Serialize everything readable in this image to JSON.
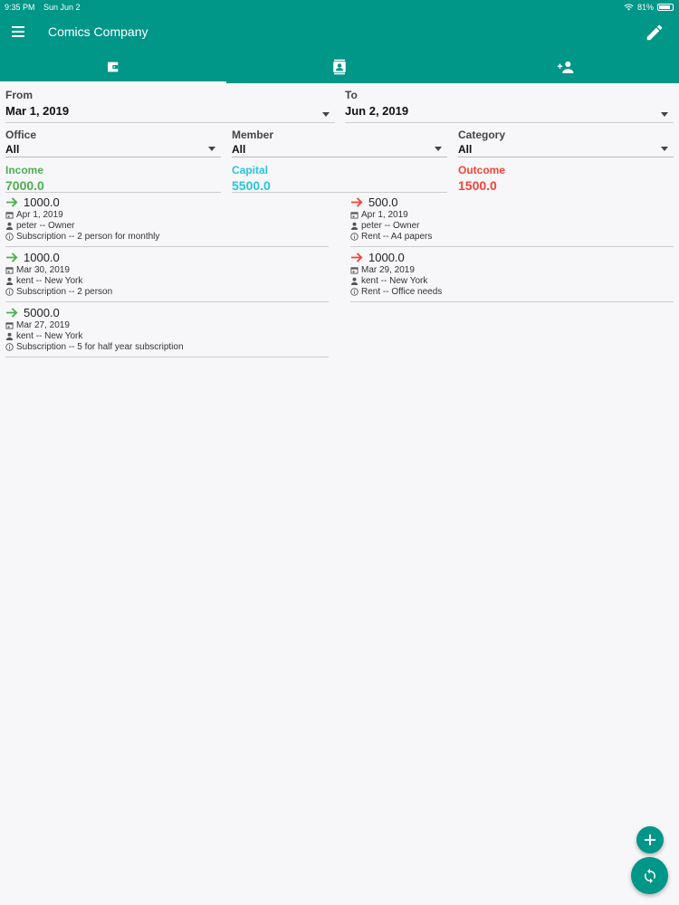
{
  "status_bar": {
    "time": "9:35 PM",
    "date": "Sun Jun 2",
    "battery": "81%"
  },
  "app": {
    "title": "Comics Company"
  },
  "tabs": [
    {
      "icon": "wallet-icon",
      "active": true
    },
    {
      "icon": "contact-card-icon",
      "active": false
    },
    {
      "icon": "add-person-icon",
      "active": false
    }
  ],
  "filters": {
    "from": {
      "label": "From",
      "value": "Mar 1, 2019"
    },
    "to": {
      "label": "To",
      "value": "Jun 2, 2019"
    },
    "office": {
      "label": "Office",
      "value": "All"
    },
    "member": {
      "label": "Member",
      "value": "All"
    },
    "category": {
      "label": "Category",
      "value": "All"
    }
  },
  "summary": {
    "income": {
      "label": "Income",
      "value": "7000.0",
      "color": "#4caf50"
    },
    "capital": {
      "label": "Capital",
      "value": "5500.0",
      "color": "#26c6da"
    },
    "outcome": {
      "label": "Outcome",
      "value": "1500.0",
      "color": "#f44336"
    }
  },
  "income_entries": [
    {
      "amount": "1000.0",
      "date": "Apr 1, 2019",
      "member": "peter -- Owner",
      "note": "Subscription -- 2 person for monthly"
    },
    {
      "amount": "1000.0",
      "date": "Mar 30, 2019",
      "member": "kent -- New York",
      "note": "Subscription -- 2 person"
    },
    {
      "amount": "5000.0",
      "date": "Mar 27, 2019",
      "member": "kent -- New York",
      "note": "Subscription -- 5 for half year subscription"
    }
  ],
  "outcome_entries": [
    {
      "amount": "500.0",
      "date": "Apr 1, 2019",
      "member": "peter -- Owner",
      "note": "Rent -- A4 papers"
    },
    {
      "amount": "1000.0",
      "date": "Mar 29, 2019",
      "member": "kent -- New York",
      "note": "Rent -- Office needs"
    }
  ],
  "colors": {
    "primary": "#009688",
    "income_arrow": "#4caf50",
    "outcome_arrow": "#f44336"
  }
}
